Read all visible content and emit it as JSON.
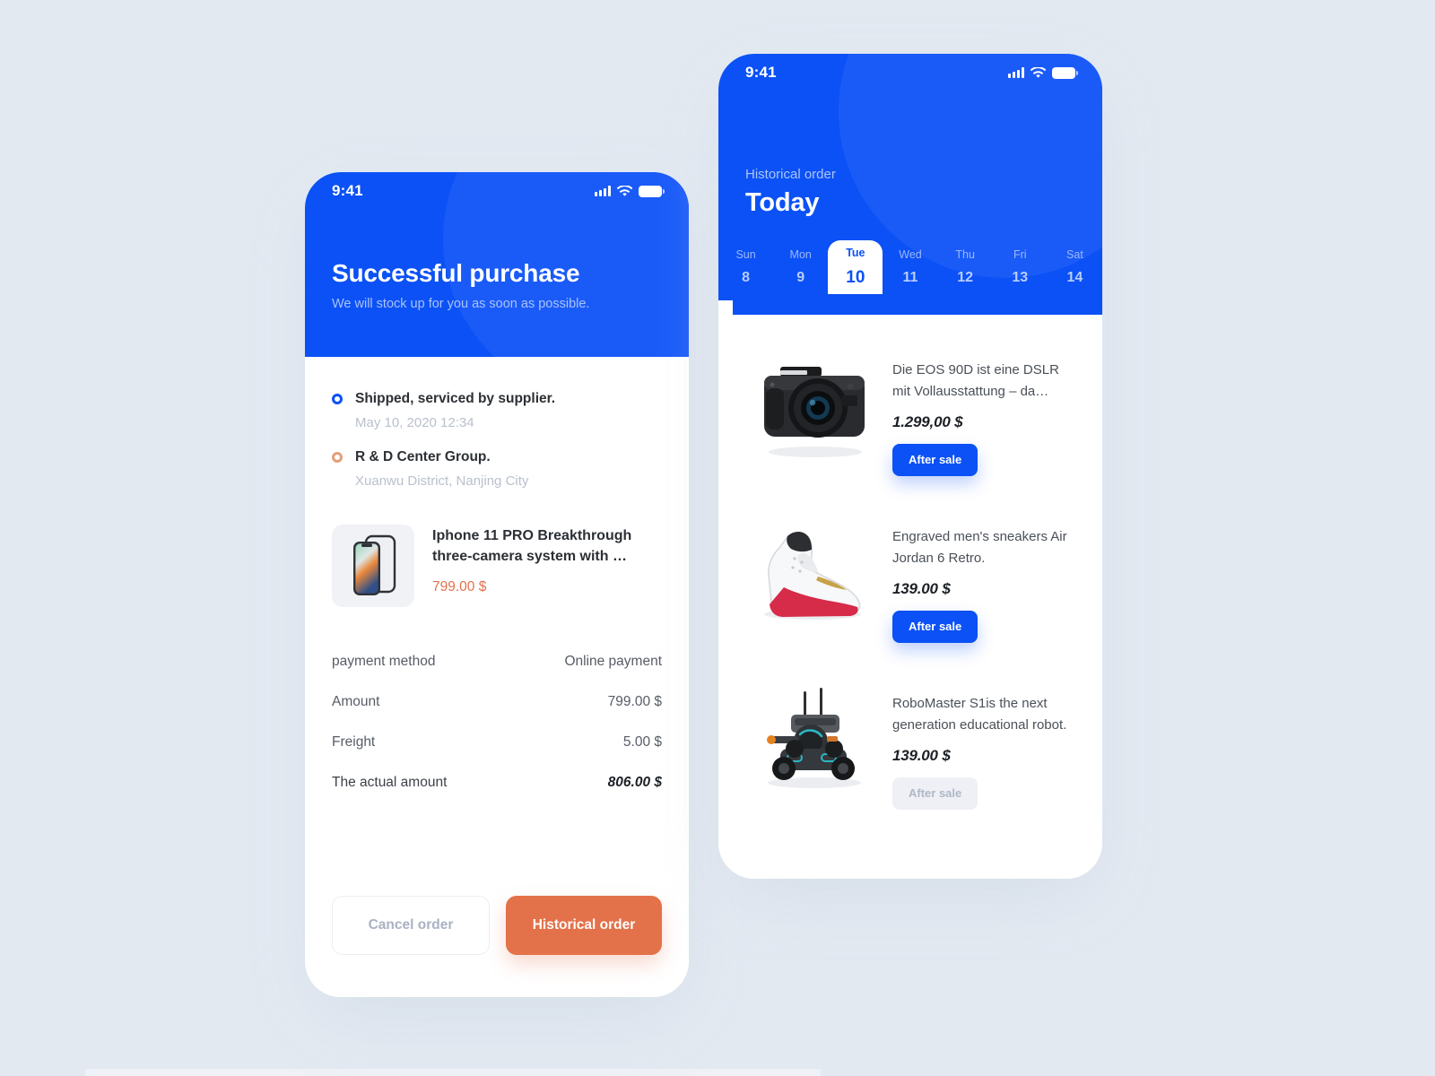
{
  "meta": {
    "accent_blue": "#0b51f5",
    "accent_orange": "#e3714a",
    "page_bg": "#e3e9f1"
  },
  "phone1": {
    "status_bar": {
      "time": "9:41"
    },
    "header": {
      "title": "Successful purchase",
      "subtitle": "We will stock up for you as soon as possible."
    },
    "timeline": [
      {
        "title": "Shipped, serviced by supplier.",
        "meta": "May 10, 2020 12:34",
        "dot": "blue"
      },
      {
        "title": "R & D Center Group.",
        "meta": "Xuanwu District, Nanjing City",
        "dot": "orange"
      }
    ],
    "product": {
      "name": "Iphone 11 PRO Breakthrough three-camera system with  …",
      "price": "799.00 $"
    },
    "summary": [
      {
        "label": "payment method",
        "value": "Online payment"
      },
      {
        "label": "Amount",
        "value": "799.00 $"
      },
      {
        "label": "Freight",
        "value": "5.00 $"
      },
      {
        "label": "The actual amount",
        "value": "806.00 $"
      }
    ],
    "buttons": {
      "cancel": "Cancel order",
      "history": "Historical order"
    }
  },
  "phone2": {
    "status_bar": {
      "time": "9:41"
    },
    "header": {
      "eyebrow": "Historical order",
      "title": "Today"
    },
    "date_strip": [
      {
        "weekday": "Sun",
        "day": "8",
        "active": false
      },
      {
        "weekday": "Mon",
        "day": "9",
        "active": false
      },
      {
        "weekday": "Tue",
        "day": "10",
        "active": true
      },
      {
        "weekday": "Wed",
        "day": "11",
        "active": false
      },
      {
        "weekday": "Thu",
        "day": "12",
        "active": false
      },
      {
        "weekday": "Fri",
        "day": "13",
        "active": false
      },
      {
        "weekday": "Sat",
        "day": "14",
        "active": false
      }
    ],
    "items": [
      {
        "image": "dslr-camera-image",
        "desc": "Die EOS 90D ist eine DSLR mit Vollausstattung – da…",
        "price": "1.299,00 $",
        "button_label": "After sale",
        "button_state": "enabled"
      },
      {
        "image": "sneaker-image",
        "desc": "Engraved men's sneakers Air Jordan 6 Retro.",
        "price": "139.00 $",
        "button_label": "After sale",
        "button_state": "enabled"
      },
      {
        "image": "robot-image",
        "desc": "RoboMaster S1is the next generation educational robot.",
        "price": "139.00 $",
        "button_label": "After sale",
        "button_state": "disabled"
      }
    ]
  }
}
